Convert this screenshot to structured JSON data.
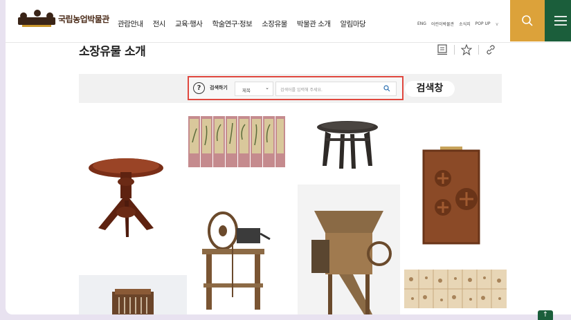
{
  "header": {
    "logo_text": "국립농업박물관",
    "nav": [
      "관람안내",
      "전시",
      "교육·행사",
      "학술연구·정보",
      "소장유물",
      "박물관 소개",
      "알림마당"
    ],
    "util": [
      "ENG",
      "어린이박물관",
      "소식지",
      "POP UP"
    ],
    "search_icon": "search-icon",
    "menu_icon": "hamburger-menu-icon"
  },
  "page": {
    "title": "소장유물 소개",
    "tools": [
      "print-icon",
      "star-icon",
      "link-icon"
    ]
  },
  "search": {
    "label": "검색하기",
    "select_value": "제목",
    "placeholder": "검색어를 입력해 주세요.",
    "callout": "검색창",
    "highlight_color": "#e0473e"
  },
  "gallery": {
    "items": [
      "round-lacquered-table",
      "folding-screen-birds-flowers",
      "small-round-table",
      "wooden-money-chest",
      "small-wooden-machine",
      "spinning-wheel",
      "winnowing-machine",
      "painted-panels"
    ]
  },
  "colors": {
    "accent_gold": "#dca23a",
    "accent_green": "#1b5e3b",
    "brand_brown": "#3a2417"
  },
  "scroll_top": "↑"
}
